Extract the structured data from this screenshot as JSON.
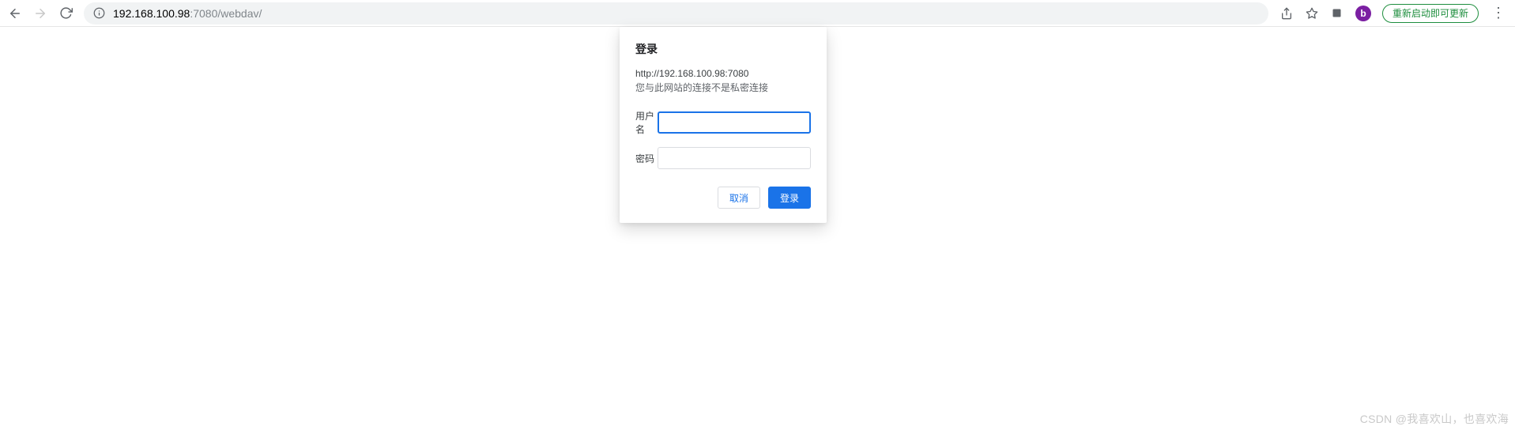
{
  "toolbar": {
    "address_host": "192.168.100.98",
    "address_port_path": ":7080/webdav/",
    "update_label": "重新启动即可更新",
    "avatar_letter": "b"
  },
  "dialog": {
    "title": "登录",
    "origin": "http://192.168.100.98:7080",
    "insecure_msg": "您与此网站的连接不是私密连接",
    "username_label": "用户名",
    "password_label": "密码",
    "cancel_label": "取消",
    "login_label": "登录",
    "username_value": "",
    "password_value": ""
  },
  "watermark": "CSDN @我喜欢山，也喜欢海"
}
